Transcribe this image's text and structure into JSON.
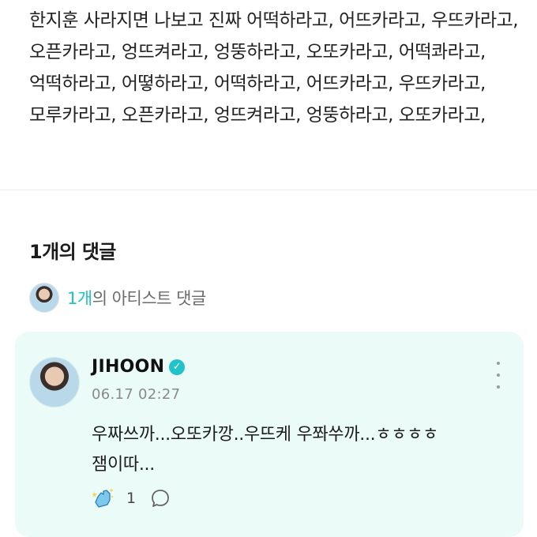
{
  "post": {
    "body": "한지훈 사라지면 나보고 진짜 어떡하라고, 어뜨카라고, 우뜨카라고, 오픈카라고, 엉뜨켜라고, 엉뚱하라고, 오또카라고, 어떡콰라고, 억떡하라고, 어뗳하라고, 어떡하라고, 어뜨카라고, 우뜨카라고, 모루카라고, 오픈카라고, 엉뜨켜라고, 엉뚱하라고, 오또카라고,"
  },
  "comments": {
    "heading": "1개의 댓글",
    "artist_summary": {
      "count": "1개",
      "label": "의 아티스트 댓글"
    }
  },
  "comment": {
    "author": "JIHOON",
    "verified": "✓",
    "timestamp": "06.17 02:27",
    "body_line1": "우짜쓰까...오또카깡..우뜨케 우쫘쑤까...ㅎㅎㅎㅎ",
    "body_line2": "잼이따...",
    "reaction_count": "1"
  },
  "colors": {
    "accent": "#1fc4c4",
    "card_bg": "#ebfbf8",
    "badge": "#22c3c8"
  },
  "icons": [
    "more-vertical-icon",
    "verified-badge-icon",
    "cheer-reaction-icon",
    "comment-bubble-icon"
  ]
}
